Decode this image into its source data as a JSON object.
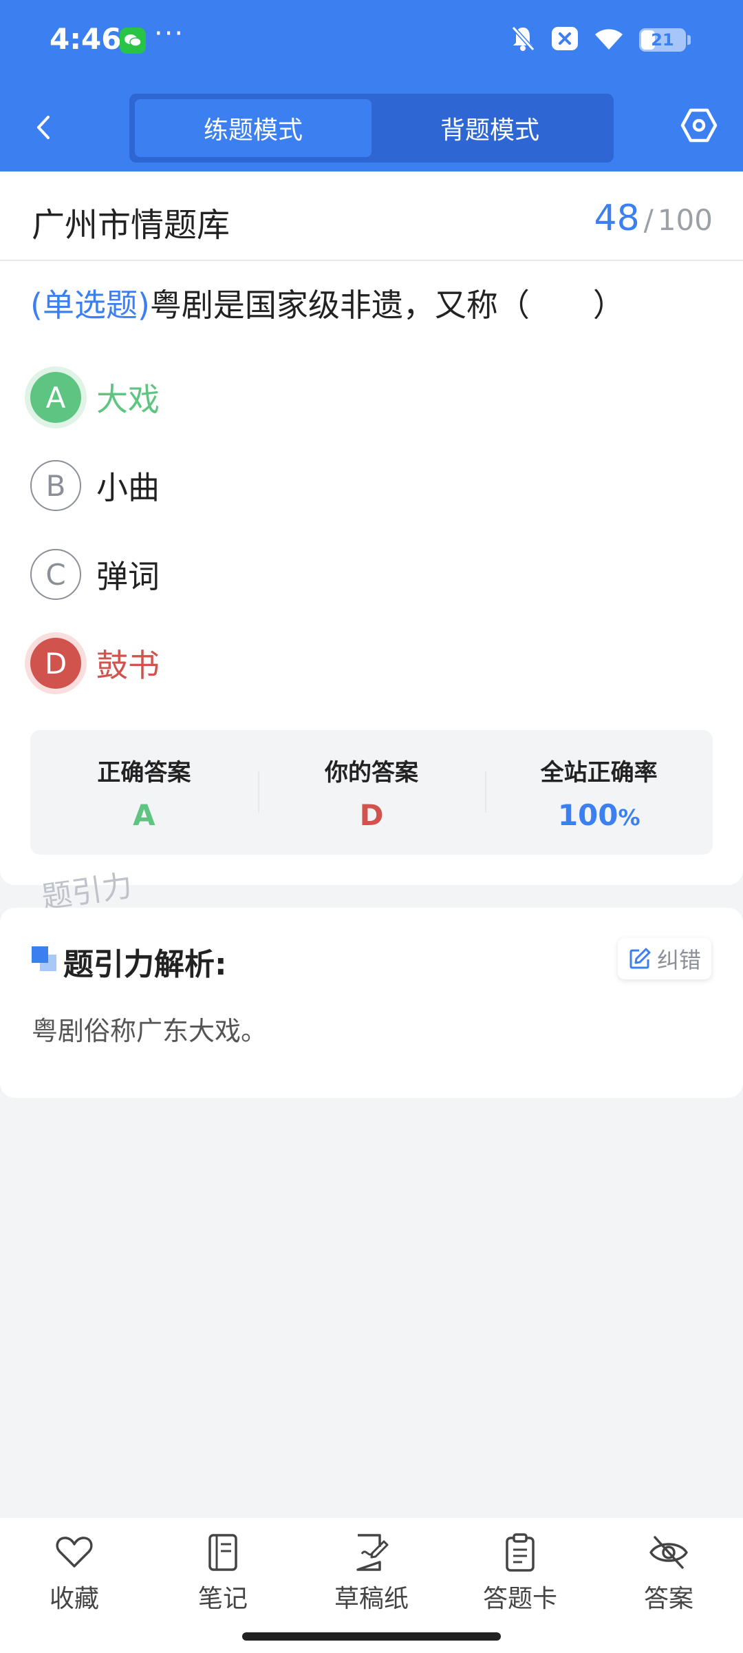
{
  "status_bar": {
    "time": "4:46",
    "battery": "21"
  },
  "header": {
    "tabs": [
      {
        "label": "练题模式",
        "active": true
      },
      {
        "label": "背题模式",
        "active": false
      }
    ]
  },
  "bank": {
    "title": "广州市情题库",
    "current": "48",
    "separator": "/",
    "total": "100"
  },
  "question": {
    "type_label": "(单选题)",
    "text": "粤剧是国家级非遗，又称（　　）",
    "options": [
      {
        "letter": "A",
        "text": "大戏",
        "state": "correct"
      },
      {
        "letter": "B",
        "text": "小曲",
        "state": "normal"
      },
      {
        "letter": "C",
        "text": "弹词",
        "state": "normal"
      },
      {
        "letter": "D",
        "text": "鼓书",
        "state": "wrong"
      }
    ]
  },
  "stats": {
    "correct_label": "正确答案",
    "correct_value": "A",
    "yours_label": "你的答案",
    "yours_value": "D",
    "rate_label": "全站正确率",
    "rate_value": "100",
    "rate_unit": "%"
  },
  "watermark": "题引力",
  "analysis": {
    "title": "题引力解析:",
    "fix_label": "纠错",
    "text": "粤剧俗称广东大戏。"
  },
  "bottom_nav": [
    {
      "icon": "heart-icon",
      "label": "收藏"
    },
    {
      "icon": "notebook-icon",
      "label": "笔记"
    },
    {
      "icon": "draft-paper-icon",
      "label": "草稿纸"
    },
    {
      "icon": "answer-sheet-icon",
      "label": "答题卡"
    },
    {
      "icon": "eye-hidden-icon",
      "label": "答案"
    }
  ],
  "colors": {
    "primary": "#3b7ff0",
    "correct": "#5ec481",
    "wrong": "#d0534d"
  }
}
